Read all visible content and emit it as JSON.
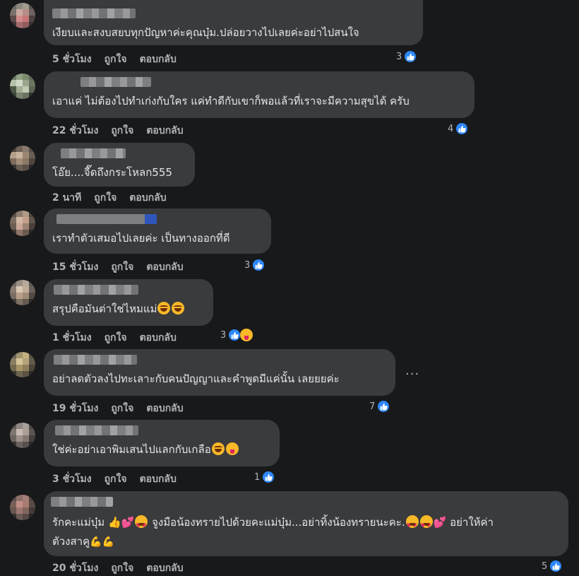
{
  "actions": {
    "like": "ถูกใจ",
    "reply": "ตอบกลับ"
  },
  "more_label": "...",
  "colors": {
    "background": "#18191a",
    "bubble": "#3a3b3c",
    "like_blue": "#2d88ff",
    "secondary_text": "#b0b3b8"
  },
  "comments": [
    {
      "text": "เงียบและสงบสยบทุกปัญหาค่ะคุณบุ๋ม.ปล่อยวางไปเลยค่ะอย่าไปสนใจ",
      "time": "5 ชั่วโมง",
      "likes": "3"
    },
    {
      "text": "เอาแค่ ไม่ต้องไปทำเก่งกับใคร แค่ทำดีกับเขาก็พอแล้วที่เราจะมีความสุขได้ ครับ",
      "time": "22 ชั่วโมง",
      "likes": "4"
    },
    {
      "text": "โอ๊ย....จี๊ดถึงกระโหลก555",
      "time": "2 นาที",
      "likes": ""
    },
    {
      "text": "เราทำตัวเสมอไปเลยค่ะ เป็นทางออกที่ดี",
      "time": "15 ชั่วโมง",
      "likes": "3"
    },
    {
      "text": "สรุปคือมันต่าใช่ไหมแม่",
      "time": "1 ชั่วโมง",
      "likes": "3"
    },
    {
      "text": "อย่าลดตัวลงไปทะเลาะกับคนปัญญาและคำพูดมีแค่นั้น เลยยยค่ะ",
      "time": "19 ชั่วโมง",
      "likes": "7"
    },
    {
      "text": "ใช่ค่ะอย่าเอาพิมเสนไปแลกกับเกลือ",
      "time": "3 ชั่วโมง",
      "likes": "1"
    },
    {
      "text_a": "รักคะแม่บุ๋ม",
      "text_b": "จูงมือน้องทรายไปด้วยคะแม่บุ๋ม...อย่าทิ้งน้องทรายนะคะ.",
      "text_c": "อย่าให้ค่า",
      "text_d": "ตัวงสาคู",
      "time": "20 ชั่วโมง",
      "likes": "5"
    }
  ]
}
